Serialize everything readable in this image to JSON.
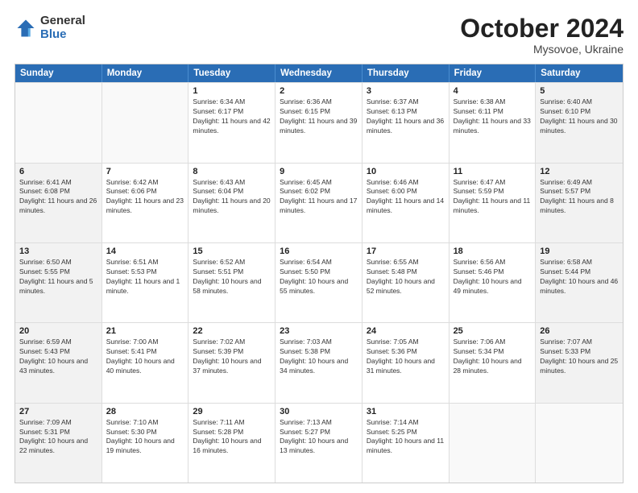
{
  "logo": {
    "general": "General",
    "blue": "Blue"
  },
  "header": {
    "month": "October 2024",
    "location": "Mysovoe, Ukraine"
  },
  "weekdays": [
    "Sunday",
    "Monday",
    "Tuesday",
    "Wednesday",
    "Thursday",
    "Friday",
    "Saturday"
  ],
  "weeks": [
    [
      {
        "day": "",
        "empty": true
      },
      {
        "day": "",
        "empty": true
      },
      {
        "day": "1",
        "sunrise": "Sunrise: 6:34 AM",
        "sunset": "Sunset: 6:17 PM",
        "daylight": "Daylight: 11 hours and 42 minutes."
      },
      {
        "day": "2",
        "sunrise": "Sunrise: 6:36 AM",
        "sunset": "Sunset: 6:15 PM",
        "daylight": "Daylight: 11 hours and 39 minutes."
      },
      {
        "day": "3",
        "sunrise": "Sunrise: 6:37 AM",
        "sunset": "Sunset: 6:13 PM",
        "daylight": "Daylight: 11 hours and 36 minutes."
      },
      {
        "day": "4",
        "sunrise": "Sunrise: 6:38 AM",
        "sunset": "Sunset: 6:11 PM",
        "daylight": "Daylight: 11 hours and 33 minutes."
      },
      {
        "day": "5",
        "sunrise": "Sunrise: 6:40 AM",
        "sunset": "Sunset: 6:10 PM",
        "daylight": "Daylight: 11 hours and 30 minutes."
      }
    ],
    [
      {
        "day": "6",
        "sunrise": "Sunrise: 6:41 AM",
        "sunset": "Sunset: 6:08 PM",
        "daylight": "Daylight: 11 hours and 26 minutes."
      },
      {
        "day": "7",
        "sunrise": "Sunrise: 6:42 AM",
        "sunset": "Sunset: 6:06 PM",
        "daylight": "Daylight: 11 hours and 23 minutes."
      },
      {
        "day": "8",
        "sunrise": "Sunrise: 6:43 AM",
        "sunset": "Sunset: 6:04 PM",
        "daylight": "Daylight: 11 hours and 20 minutes."
      },
      {
        "day": "9",
        "sunrise": "Sunrise: 6:45 AM",
        "sunset": "Sunset: 6:02 PM",
        "daylight": "Daylight: 11 hours and 17 minutes."
      },
      {
        "day": "10",
        "sunrise": "Sunrise: 6:46 AM",
        "sunset": "Sunset: 6:00 PM",
        "daylight": "Daylight: 11 hours and 14 minutes."
      },
      {
        "day": "11",
        "sunrise": "Sunrise: 6:47 AM",
        "sunset": "Sunset: 5:59 PM",
        "daylight": "Daylight: 11 hours and 11 minutes."
      },
      {
        "day": "12",
        "sunrise": "Sunrise: 6:49 AM",
        "sunset": "Sunset: 5:57 PM",
        "daylight": "Daylight: 11 hours and 8 minutes."
      }
    ],
    [
      {
        "day": "13",
        "sunrise": "Sunrise: 6:50 AM",
        "sunset": "Sunset: 5:55 PM",
        "daylight": "Daylight: 11 hours and 5 minutes."
      },
      {
        "day": "14",
        "sunrise": "Sunrise: 6:51 AM",
        "sunset": "Sunset: 5:53 PM",
        "daylight": "Daylight: 11 hours and 1 minute."
      },
      {
        "day": "15",
        "sunrise": "Sunrise: 6:52 AM",
        "sunset": "Sunset: 5:51 PM",
        "daylight": "Daylight: 10 hours and 58 minutes."
      },
      {
        "day": "16",
        "sunrise": "Sunrise: 6:54 AM",
        "sunset": "Sunset: 5:50 PM",
        "daylight": "Daylight: 10 hours and 55 minutes."
      },
      {
        "day": "17",
        "sunrise": "Sunrise: 6:55 AM",
        "sunset": "Sunset: 5:48 PM",
        "daylight": "Daylight: 10 hours and 52 minutes."
      },
      {
        "day": "18",
        "sunrise": "Sunrise: 6:56 AM",
        "sunset": "Sunset: 5:46 PM",
        "daylight": "Daylight: 10 hours and 49 minutes."
      },
      {
        "day": "19",
        "sunrise": "Sunrise: 6:58 AM",
        "sunset": "Sunset: 5:44 PM",
        "daylight": "Daylight: 10 hours and 46 minutes."
      }
    ],
    [
      {
        "day": "20",
        "sunrise": "Sunrise: 6:59 AM",
        "sunset": "Sunset: 5:43 PM",
        "daylight": "Daylight: 10 hours and 43 minutes."
      },
      {
        "day": "21",
        "sunrise": "Sunrise: 7:00 AM",
        "sunset": "Sunset: 5:41 PM",
        "daylight": "Daylight: 10 hours and 40 minutes."
      },
      {
        "day": "22",
        "sunrise": "Sunrise: 7:02 AM",
        "sunset": "Sunset: 5:39 PM",
        "daylight": "Daylight: 10 hours and 37 minutes."
      },
      {
        "day": "23",
        "sunrise": "Sunrise: 7:03 AM",
        "sunset": "Sunset: 5:38 PM",
        "daylight": "Daylight: 10 hours and 34 minutes."
      },
      {
        "day": "24",
        "sunrise": "Sunrise: 7:05 AM",
        "sunset": "Sunset: 5:36 PM",
        "daylight": "Daylight: 10 hours and 31 minutes."
      },
      {
        "day": "25",
        "sunrise": "Sunrise: 7:06 AM",
        "sunset": "Sunset: 5:34 PM",
        "daylight": "Daylight: 10 hours and 28 minutes."
      },
      {
        "day": "26",
        "sunrise": "Sunrise: 7:07 AM",
        "sunset": "Sunset: 5:33 PM",
        "daylight": "Daylight: 10 hours and 25 minutes."
      }
    ],
    [
      {
        "day": "27",
        "sunrise": "Sunrise: 7:09 AM",
        "sunset": "Sunset: 5:31 PM",
        "daylight": "Daylight: 10 hours and 22 minutes."
      },
      {
        "day": "28",
        "sunrise": "Sunrise: 7:10 AM",
        "sunset": "Sunset: 5:30 PM",
        "daylight": "Daylight: 10 hours and 19 minutes."
      },
      {
        "day": "29",
        "sunrise": "Sunrise: 7:11 AM",
        "sunset": "Sunset: 5:28 PM",
        "daylight": "Daylight: 10 hours and 16 minutes."
      },
      {
        "day": "30",
        "sunrise": "Sunrise: 7:13 AM",
        "sunset": "Sunset: 5:27 PM",
        "daylight": "Daylight: 10 hours and 13 minutes."
      },
      {
        "day": "31",
        "sunrise": "Sunrise: 7:14 AM",
        "sunset": "Sunset: 5:25 PM",
        "daylight": "Daylight: 10 hours and 11 minutes."
      },
      {
        "day": "",
        "empty": true
      },
      {
        "day": "",
        "empty": true
      }
    ]
  ]
}
